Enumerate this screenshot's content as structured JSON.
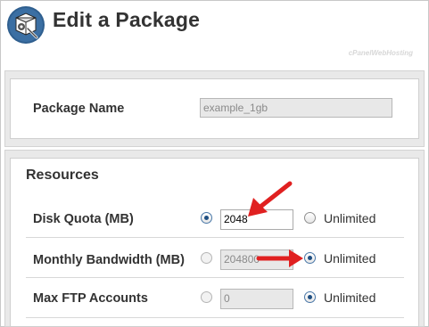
{
  "header": {
    "title": "Edit a Package",
    "watermark": "cPanelWebHosting",
    "logo_icon": "package-settings-icon"
  },
  "package": {
    "name_label": "Package Name",
    "name_value": "example_1gb"
  },
  "resources": {
    "heading": "Resources",
    "rows": [
      {
        "label": "Disk Quota (MB)",
        "value": "2048",
        "value_selected": true,
        "unlimited_label": "Unlimited",
        "unlimited_selected": false
      },
      {
        "label": "Monthly Bandwidth (MB)",
        "value": "204800",
        "value_selected": false,
        "unlimited_label": "Unlimited",
        "unlimited_selected": true
      },
      {
        "label": "Max FTP Accounts",
        "value": "0",
        "value_selected": false,
        "unlimited_label": "Unlimited",
        "unlimited_selected": true
      }
    ]
  },
  "colors": {
    "annotation_arrow": "#e02020",
    "logo_circle": "#2f5f8f"
  }
}
